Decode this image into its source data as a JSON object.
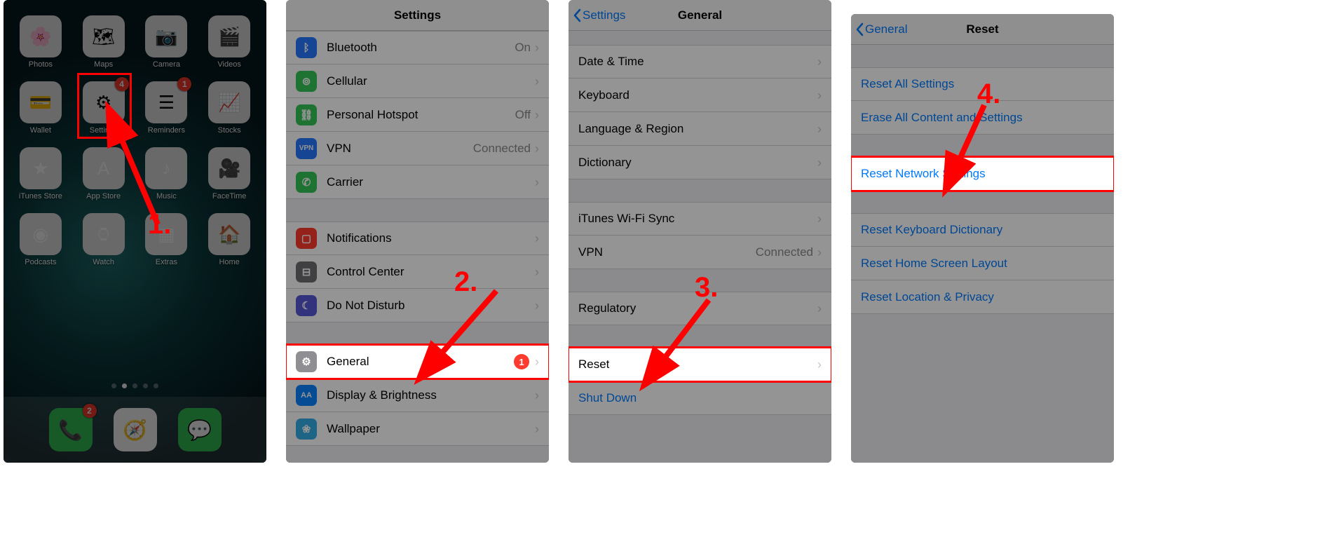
{
  "steps": {
    "s1": "1.",
    "s2": "2.",
    "s3": "3.",
    "s4": "4."
  },
  "panel1": {
    "apps": [
      {
        "label": "Photos",
        "glyph": "🌸"
      },
      {
        "label": "Maps",
        "glyph": "🗺"
      },
      {
        "label": "Camera",
        "glyph": "📷"
      },
      {
        "label": "Videos",
        "glyph": "🎬"
      },
      {
        "label": "Wallet",
        "glyph": "💳"
      },
      {
        "label": "Settings",
        "glyph": "⚙︎",
        "badge": "4",
        "highlight": true
      },
      {
        "label": "Reminders",
        "glyph": "☰",
        "badge": "1"
      },
      {
        "label": "Stocks",
        "glyph": "📈"
      },
      {
        "label": "iTunes Store",
        "glyph": "★"
      },
      {
        "label": "App Store",
        "glyph": "A"
      },
      {
        "label": "Music",
        "glyph": "♪"
      },
      {
        "label": "FaceTime",
        "glyph": "🎥"
      },
      {
        "label": "Podcasts",
        "glyph": "◉"
      },
      {
        "label": "Watch",
        "glyph": "⌚︎"
      },
      {
        "label": "Extras",
        "glyph": "▦"
      },
      {
        "label": "Home",
        "glyph": "🏠"
      }
    ],
    "dock": [
      {
        "name": "Phone",
        "glyph": "📞",
        "badge": "2"
      },
      {
        "name": "Safari",
        "glyph": "🧭"
      },
      {
        "name": "Messages",
        "glyph": "💬"
      }
    ]
  },
  "panel2": {
    "title": "Settings",
    "rows": [
      {
        "icon": "i-bt",
        "label": "Bluetooth",
        "value": "On"
      },
      {
        "icon": "i-cell",
        "label": "Cellular"
      },
      {
        "icon": "i-ph",
        "label": "Personal Hotspot",
        "value": "Off"
      },
      {
        "icon": "i-vpn",
        "iconText": "VPN",
        "label": "VPN",
        "value": "Connected"
      },
      {
        "icon": "i-car",
        "label": "Carrier"
      }
    ],
    "rows2": [
      {
        "icon": "i-not",
        "label": "Notifications"
      },
      {
        "icon": "i-cc",
        "label": "Control Center"
      },
      {
        "icon": "i-dnd",
        "label": "Do Not Disturb"
      }
    ],
    "rows3": [
      {
        "icon": "i-gen",
        "label": "General",
        "badge": "1",
        "highlight": true
      },
      {
        "icon": "i-disp",
        "iconText": "AA",
        "label": "Display & Brightness"
      },
      {
        "icon": "i-wall",
        "label": "Wallpaper"
      }
    ]
  },
  "panel3": {
    "back": "Settings",
    "title": "General",
    "rows": [
      {
        "label": "Date & Time"
      },
      {
        "label": "Keyboard"
      },
      {
        "label": "Language & Region"
      },
      {
        "label": "Dictionary"
      }
    ],
    "rows2": [
      {
        "label": "iTunes Wi-Fi Sync"
      },
      {
        "label": "VPN",
        "value": "Connected"
      }
    ],
    "rows3": [
      {
        "label": "Regulatory"
      }
    ],
    "rows4": [
      {
        "label": "Reset",
        "highlight": true
      }
    ],
    "shutdown": "Shut Down"
  },
  "panel4": {
    "back": "General",
    "title": "Reset",
    "rows": [
      {
        "label": "Reset All Settings"
      },
      {
        "label": "Erase All Content and Settings"
      }
    ],
    "rows2": [
      {
        "label": "Reset Network Settings",
        "highlight": true
      }
    ],
    "rows3": [
      {
        "label": "Reset Keyboard Dictionary"
      },
      {
        "label": "Reset Home Screen Layout"
      },
      {
        "label": "Reset Location & Privacy"
      }
    ]
  }
}
